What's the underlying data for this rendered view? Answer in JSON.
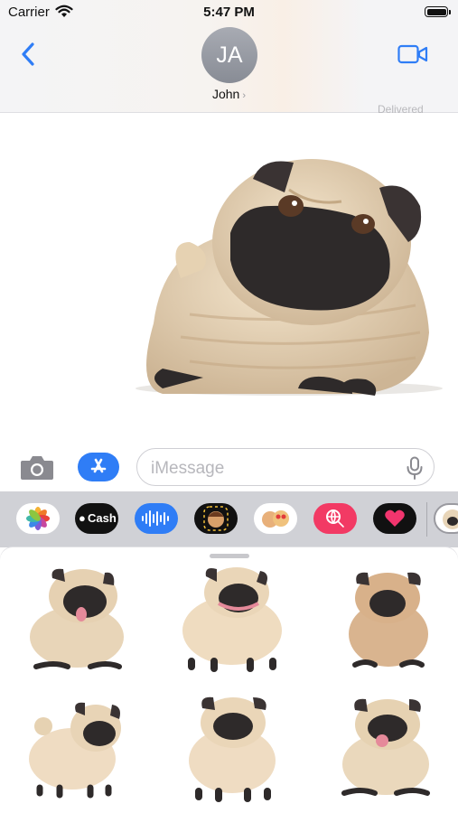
{
  "status_bar": {
    "carrier": "Carrier",
    "time": "5:47 PM"
  },
  "header": {
    "avatar_initials": "JA",
    "contact_name": "John",
    "chevron": "›"
  },
  "conversation": {
    "status_text": "Delivered",
    "sent_sticker": "large-pug-sticker"
  },
  "composer": {
    "placeholder": "iMessage"
  },
  "app_strip": {
    "items": [
      {
        "name": "photos-app",
        "label": ""
      },
      {
        "name": "apple-cash-app",
        "label": "Cash"
      },
      {
        "name": "audio-message-app",
        "label": ""
      },
      {
        "name": "memoji-app",
        "label": ""
      },
      {
        "name": "memoji-stickers-app",
        "label": ""
      },
      {
        "name": "images-search-app",
        "label": ""
      },
      {
        "name": "digital-touch-app",
        "label": ""
      },
      {
        "name": "pug-stickers-app",
        "label": ""
      }
    ]
  },
  "sticker_drawer": {
    "stickers": [
      "pug-tongue-sitting",
      "pug-standing-wide",
      "pug-sitting-tan",
      "pug-curly-tail",
      "pug-standing-front",
      "pug-sitting-tongue"
    ]
  },
  "colors": {
    "accent": "#2f7df6",
    "pug_fur": "#e8d5b8",
    "pug_mask": "#2e2a2a"
  }
}
